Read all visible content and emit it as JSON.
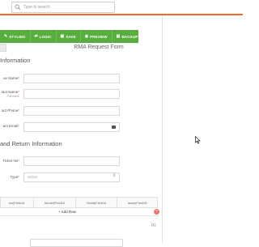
{
  "search": {
    "placeholder": "Type to search"
  },
  "toolbar": {
    "buttons": [
      {
        "icon": "✎",
        "label": "STYLING"
      },
      {
        "icon": "⇄",
        "label": "LOGIC"
      },
      {
        "icon": "▣",
        "label": "SAVE"
      },
      {
        "icon": "◉",
        "label": "PREVIEW"
      },
      {
        "icon": "▤",
        "label": "BACKUP"
      }
    ]
  },
  "form": {
    "title": "RMA Request Form",
    "section1": "Information",
    "fields": {
      "venue_name": {
        "label": "ue Name",
        "required": "*"
      },
      "contact_name": {
        "label": "tact Name",
        "required": "*",
        "sublabel": "Full name"
      },
      "contact_phone": {
        "label": "act Phone",
        "required": "*"
      },
      "contact_email": {
        "label": "act Email",
        "required": "*"
      },
      "ticket_no": {
        "label": "Ticket No",
        "required": "*"
      },
      "type": {
        "label": "Type",
        "required": "*",
        "value": "Select"
      }
    },
    "section2": "and Return Information",
    "table": {
      "columns": [
        "ice|Field16",
        "Model|Field15",
        "Serial|Field14",
        "Issue|Field18"
      ],
      "add_row": "+ Add Row",
      "remove": "×",
      "count": "(1)"
    }
  },
  "colors": {
    "accent_orange": "#f26a2e",
    "toolbar_green": "#58ad3f",
    "required_red": "#d9534f"
  }
}
